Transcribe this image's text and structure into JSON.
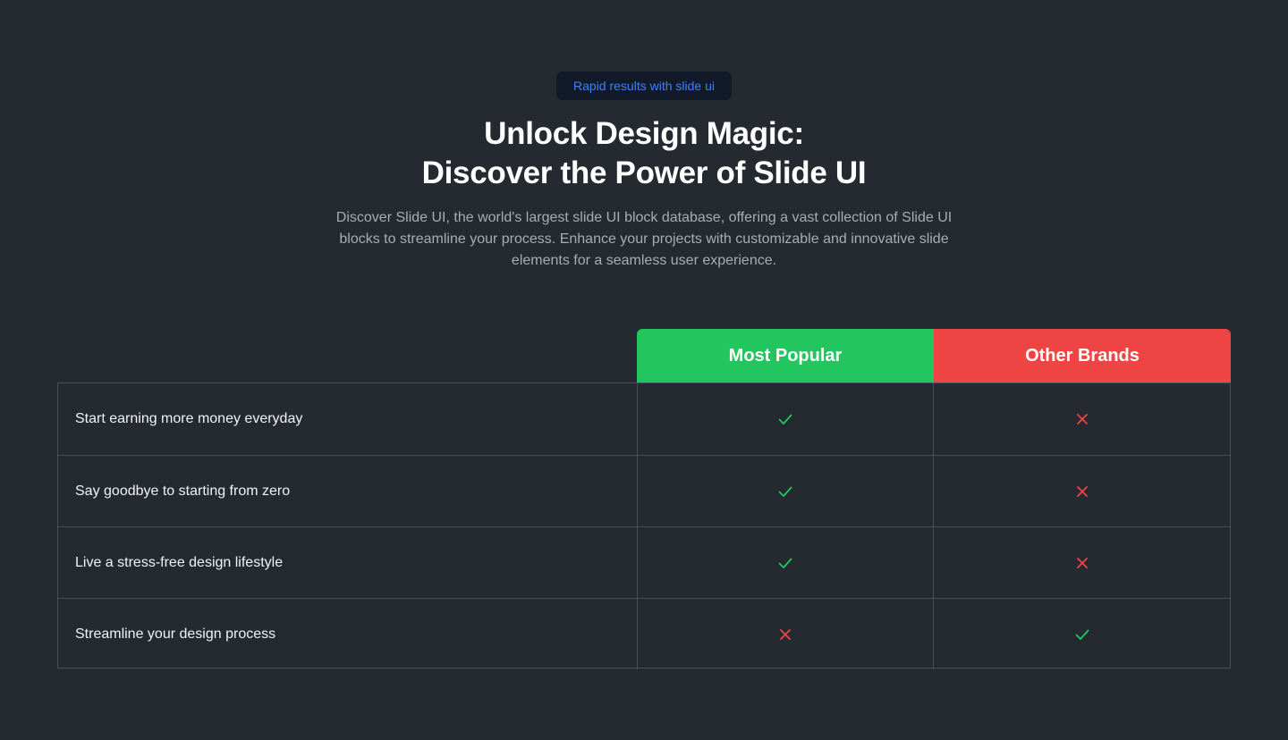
{
  "badge": "Rapid results with slide ui",
  "heading": {
    "line1": "Unlock Design Magic:",
    "line2": "Discover the Power of Slide UI"
  },
  "description": "Discover Slide UI, the world's largest slide UI block database, offering a vast collection of Slide UI blocks to streamline your process. Enhance your projects with customizable and innovative slide elements for a seamless user experience.",
  "comparison": {
    "columns": [
      "Most Popular",
      "Other Brands"
    ],
    "rows": [
      {
        "label": "Start earning more money everyday",
        "popular": "check-icon",
        "other": "cross-icon"
      },
      {
        "label": "Say goodbye to starting from zero",
        "popular": "check-icon",
        "other": "cross-icon"
      },
      {
        "label": "Live a stress-free design lifestyle",
        "popular": "check-icon",
        "other": "cross-icon"
      },
      {
        "label": "Streamline your design process",
        "popular": "cross-icon",
        "other": "check-icon"
      }
    ]
  },
  "colors": {
    "background": "#252a31",
    "accent_blue": "#3b82f6",
    "green": "#22c55e",
    "red": "#ef4444"
  }
}
